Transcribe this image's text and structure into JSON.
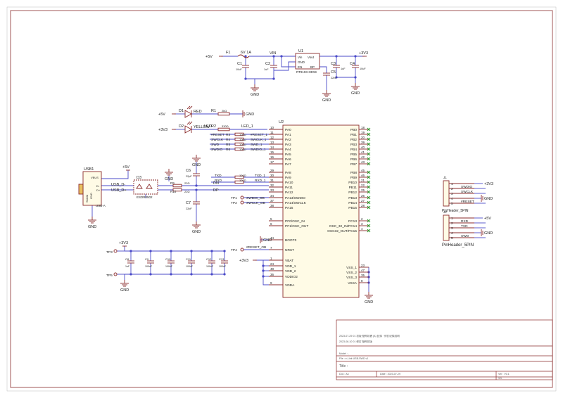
{
  "power": {
    "p5v": "+5V",
    "p3v3": "+3V3",
    "gnd": "GND",
    "vin": "VIN"
  },
  "fuse": {
    "ref": "F1",
    "value": "6V 1A"
  },
  "regulator": {
    "ref": "U1",
    "pins": [
      "Vin",
      "Vout",
      "GND",
      "EN",
      "BP"
    ],
    "pin_numbers": [
      "1",
      "5",
      "2",
      "3",
      "4"
    ],
    "part": "RT9193-33GB"
  },
  "caps_top": [
    {
      "ref": "C1",
      "value": "10uF"
    },
    {
      "ref": "C2",
      "value": "1uF"
    },
    {
      "ref": "C3",
      "value": "1uF"
    },
    {
      "ref": "C4",
      "value": "10uF"
    },
    {
      "ref": "C5",
      "value": "22nF"
    }
  ],
  "leds": [
    {
      "ref": "D1",
      "color": "RED",
      "res_ref": "R1",
      "res_val": "2kΩ",
      "rail": "+5V"
    },
    {
      "ref": "D2",
      "color": "YELLOW",
      "res_ref": "R2",
      "res_val": "330Ω",
      "net": "LED",
      "net_out": "LED_1",
      "rail": "+3V3"
    }
  ],
  "mcu_left_nets": [
    {
      "net": "#RESET",
      "res": "R3",
      "val": "100Ω",
      "out": "#RESET_1"
    },
    {
      "net": "SWCLK",
      "res": "R4",
      "val": "100Ω",
      "out": "SWCLK_1"
    },
    {
      "net": "SWD",
      "res": "R5",
      "val": "100Ω",
      "out": "SWD_1"
    },
    {
      "net": "SWDIO",
      "res": "R6",
      "val": "100Ω",
      "out": "SWDIO_1"
    }
  ],
  "uart_nets": [
    {
      "net": "TXD",
      "res": "R7",
      "val": "100Ω",
      "out": "TXD_1"
    },
    {
      "net": "RXD",
      "res": "R8",
      "val": "100Ω",
      "out": "RXD_1"
    }
  ],
  "usb": {
    "ref": "USB1",
    "type": "USB-A",
    "pins": [
      "VBUS",
      "D-",
      "D+",
      "GND"
    ],
    "shield": "Shield",
    "dm": "USB_D-",
    "dp": "USB_D+",
    "esd_ref": "D3",
    "esd_part": "ESDR0502",
    "r9": "R9",
    "r9v": "22Ω",
    "r10": "R10",
    "r10v": "22Ω",
    "dn": "DN",
    "dpn": "DP",
    "c6": "C6",
    "c6v": "22pF",
    "c7": "C7",
    "c7v": "22pF"
  },
  "mcu": {
    "ref": "U2",
    "left_pins": [
      {
        "num": "10",
        "name": "PA0"
      },
      {
        "num": "11",
        "name": "PA1"
      },
      {
        "num": "12",
        "name": "PA2"
      },
      {
        "num": "13",
        "name": "PA3"
      },
      {
        "num": "14",
        "name": "PA4"
      },
      {
        "num": "15",
        "name": "PA5"
      },
      {
        "num": "16",
        "name": "PA6"
      },
      {
        "num": "17",
        "name": "PA7"
      },
      {
        "num": "29",
        "name": "PA8"
      },
      {
        "num": "30",
        "name": "PA9"
      },
      {
        "num": "31",
        "name": "PA10"
      },
      {
        "num": "32",
        "name": "PA11"
      },
      {
        "num": "33",
        "name": "PA12"
      },
      {
        "num": "34",
        "name": "PA13/SWDIO"
      },
      {
        "num": "37",
        "name": "PA14/SWCLK"
      },
      {
        "num": "38",
        "name": "PA15"
      },
      {
        "num": "5",
        "name": "PF0/OSC_IN"
      },
      {
        "num": "6",
        "name": "PF1/OSC_OUT"
      },
      {
        "num": "44",
        "name": "BOOT0"
      },
      {
        "num": "7",
        "name": "NRST"
      },
      {
        "num": "1",
        "name": "VBAT"
      },
      {
        "num": "24",
        "name": "VDD_1"
      },
      {
        "num": "48",
        "name": "VDD_2"
      },
      {
        "num": "36",
        "name": "VDDIO2"
      },
      {
        "num": "9",
        "name": "VDDA"
      }
    ],
    "right_pins": [
      {
        "num": "18",
        "name": "PB0"
      },
      {
        "num": "19",
        "name": "PB1"
      },
      {
        "num": "20",
        "name": "PB2"
      },
      {
        "num": "39",
        "name": "PB3"
      },
      {
        "num": "40",
        "name": "PB4"
      },
      {
        "num": "41",
        "name": "PB5"
      },
      {
        "num": "42",
        "name": "PB6"
      },
      {
        "num": "43",
        "name": "PB7"
      },
      {
        "num": "45",
        "name": "PB8"
      },
      {
        "num": "46",
        "name": "PB9"
      },
      {
        "num": "21",
        "name": "PB10"
      },
      {
        "num": "22",
        "name": "PB11"
      },
      {
        "num": "25",
        "name": "PB12"
      },
      {
        "num": "26",
        "name": "PB13"
      },
      {
        "num": "27",
        "name": "PB14"
      },
      {
        "num": "28",
        "name": "PB15"
      },
      {
        "num": "2",
        "name": "PC13"
      },
      {
        "num": "3",
        "name": "OSC_32_IN/PC14"
      },
      {
        "num": "4",
        "name": "OSC32_OUT/PC15"
      },
      {
        "num": "23",
        "name": "VSS_1"
      },
      {
        "num": "47",
        "name": "VSS_2"
      },
      {
        "num": "35",
        "name": "VSS_3"
      },
      {
        "num": "8",
        "name": "VSSA"
      }
    ],
    "swd_labels": [
      "SWDIO_OB",
      "SWCLK_OB"
    ],
    "nrst_label": "#RESET_OB"
  },
  "testpoints": [
    "TP1",
    "TP2",
    "TP3",
    "TP4",
    "TP5"
  ],
  "decoupling": [
    {
      "ref": "C8",
      "value": "1uF"
    },
    {
      "ref": "C9",
      "value": "100nF"
    },
    {
      "ref": "C10",
      "value": "100nF"
    },
    {
      "ref": "C11",
      "value": "100nF"
    },
    {
      "ref": "C12",
      "value": "100nF"
    },
    {
      "ref": "C13",
      "value": "100nF"
    }
  ],
  "headers": [
    {
      "ref": "J1",
      "name": "PinHeader_5PIN",
      "pins": [
        "1",
        "2",
        "3",
        "4",
        "5"
      ],
      "nets": [
        "+3V3",
        "SWDIO",
        "SWCLK",
        "GND",
        "#RESET"
      ]
    },
    {
      "ref": "J2",
      "name": "PinHeader_5PIN",
      "pins": [
        "1",
        "2",
        "3",
        "4",
        "5"
      ],
      "nets": [
        "+5V",
        "RXD",
        "TXD",
        "GND",
        "SWD"
      ]
    }
  ],
  "title_block": {
    "rev1": "2023-07-29 01 初版 發佈初稿 (A) 記錄 · 修訂紀錄說明",
    "rev2": "2023-08-10 01 修訂 發佈初版",
    "model": "Model : -",
    "file": "File : e-Link USB-SWD v1",
    "title": "Title :",
    "doc": "Doc : A4",
    "date": "Date : 2023-07-29",
    "ver": "Ver : V0.1",
    "sheet": "1/1"
  }
}
